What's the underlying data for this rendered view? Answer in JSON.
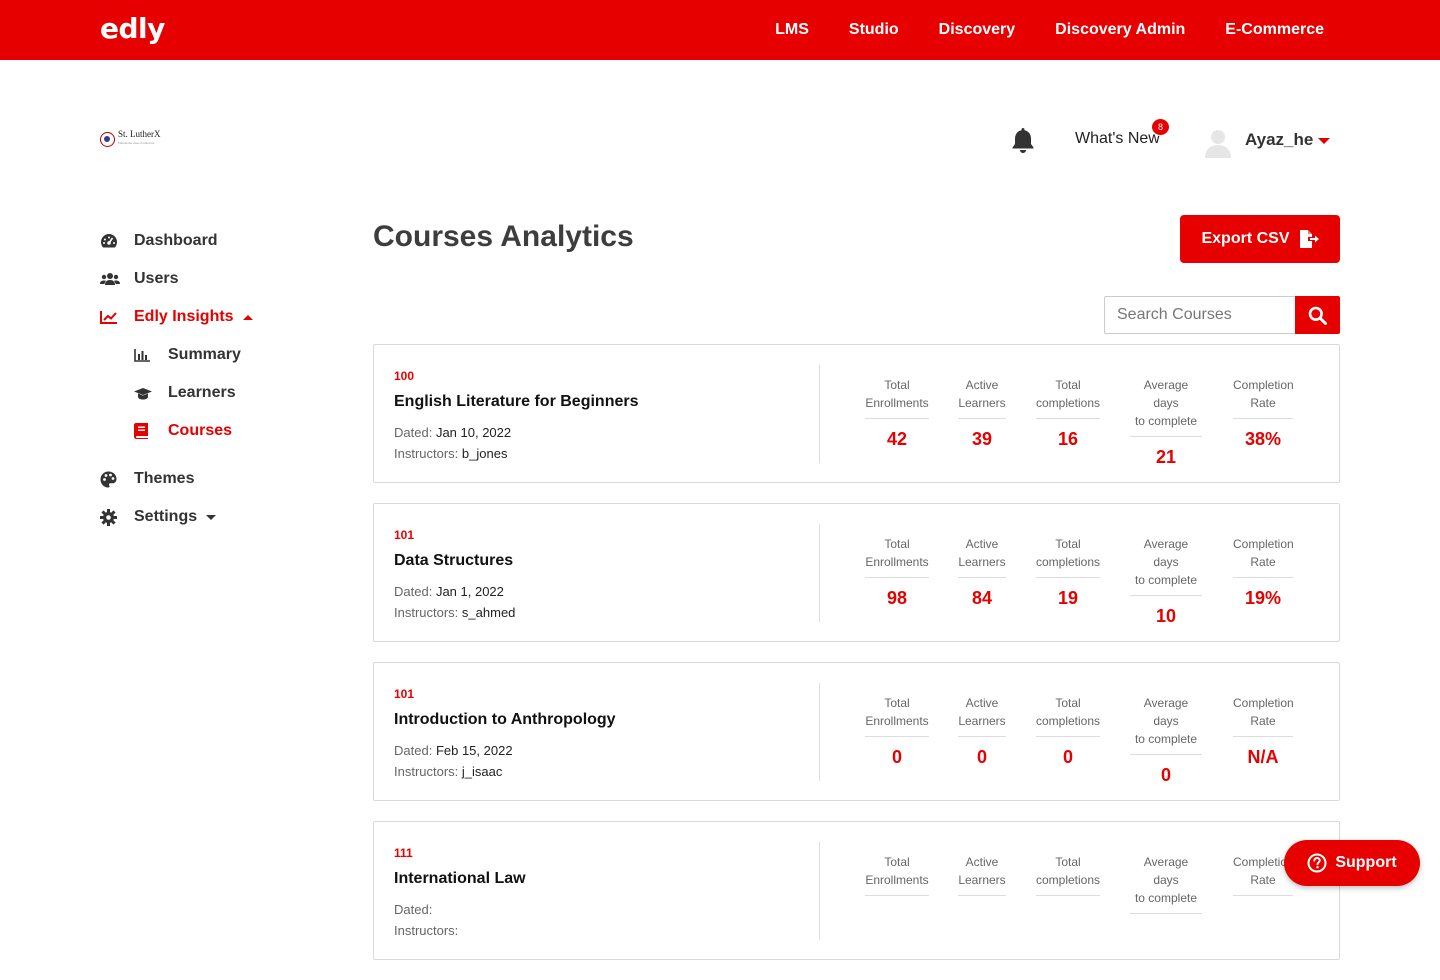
{
  "brand": {
    "logo_text": "edly",
    "accent": "#e60000"
  },
  "topnav": [
    "LMS",
    "Studio",
    "Discovery",
    "Discovery Admin",
    "E-Commerce"
  ],
  "org": {
    "name": "St. LutherX",
    "tagline": "Educate the class of tomorrow"
  },
  "header": {
    "whats_new": "What's New",
    "notification_count": "8",
    "username": "Ayaz_he"
  },
  "sidebar": {
    "dashboard": "Dashboard",
    "users": "Users",
    "insights": "Edly Insights",
    "summary": "Summary",
    "learners": "Learners",
    "courses": "Courses",
    "themes": "Themes",
    "settings": "Settings"
  },
  "page": {
    "title": "Courses Analytics",
    "export_label": "Export CSV",
    "search_placeholder": "Search Courses"
  },
  "labels": {
    "dated": "Dated:",
    "instructors": "Instructors:"
  },
  "stat_labels": [
    [
      "Total",
      "Enrollments"
    ],
    [
      "Active",
      "Learners"
    ],
    [
      "Total",
      "completions"
    ],
    [
      "Average days",
      "to complete"
    ],
    [
      "Completion",
      "Rate"
    ]
  ],
  "courses": [
    {
      "id": "100",
      "name": "English Literature for Beginners",
      "dated": "Jan 10, 2022",
      "instructors": "b_jones",
      "stats": [
        "42",
        "39",
        "16",
        "21",
        "38%"
      ]
    },
    {
      "id": "101",
      "name": "Data Structures",
      "dated": "Jan 1, 2022",
      "instructors": "s_ahmed",
      "stats": [
        "98",
        "84",
        "19",
        "10",
        "19%"
      ]
    },
    {
      "id": "101",
      "name": "Introduction to Anthropology",
      "dated": "Feb 15, 2022",
      "instructors": "j_isaac",
      "stats": [
        "0",
        "0",
        "0",
        "0",
        "N/A"
      ]
    },
    {
      "id": "111",
      "name": "International Law",
      "dated": "",
      "instructors": "",
      "stats": [
        "",
        "",
        "",
        "",
        ""
      ]
    }
  ],
  "support": {
    "label": "Support"
  }
}
